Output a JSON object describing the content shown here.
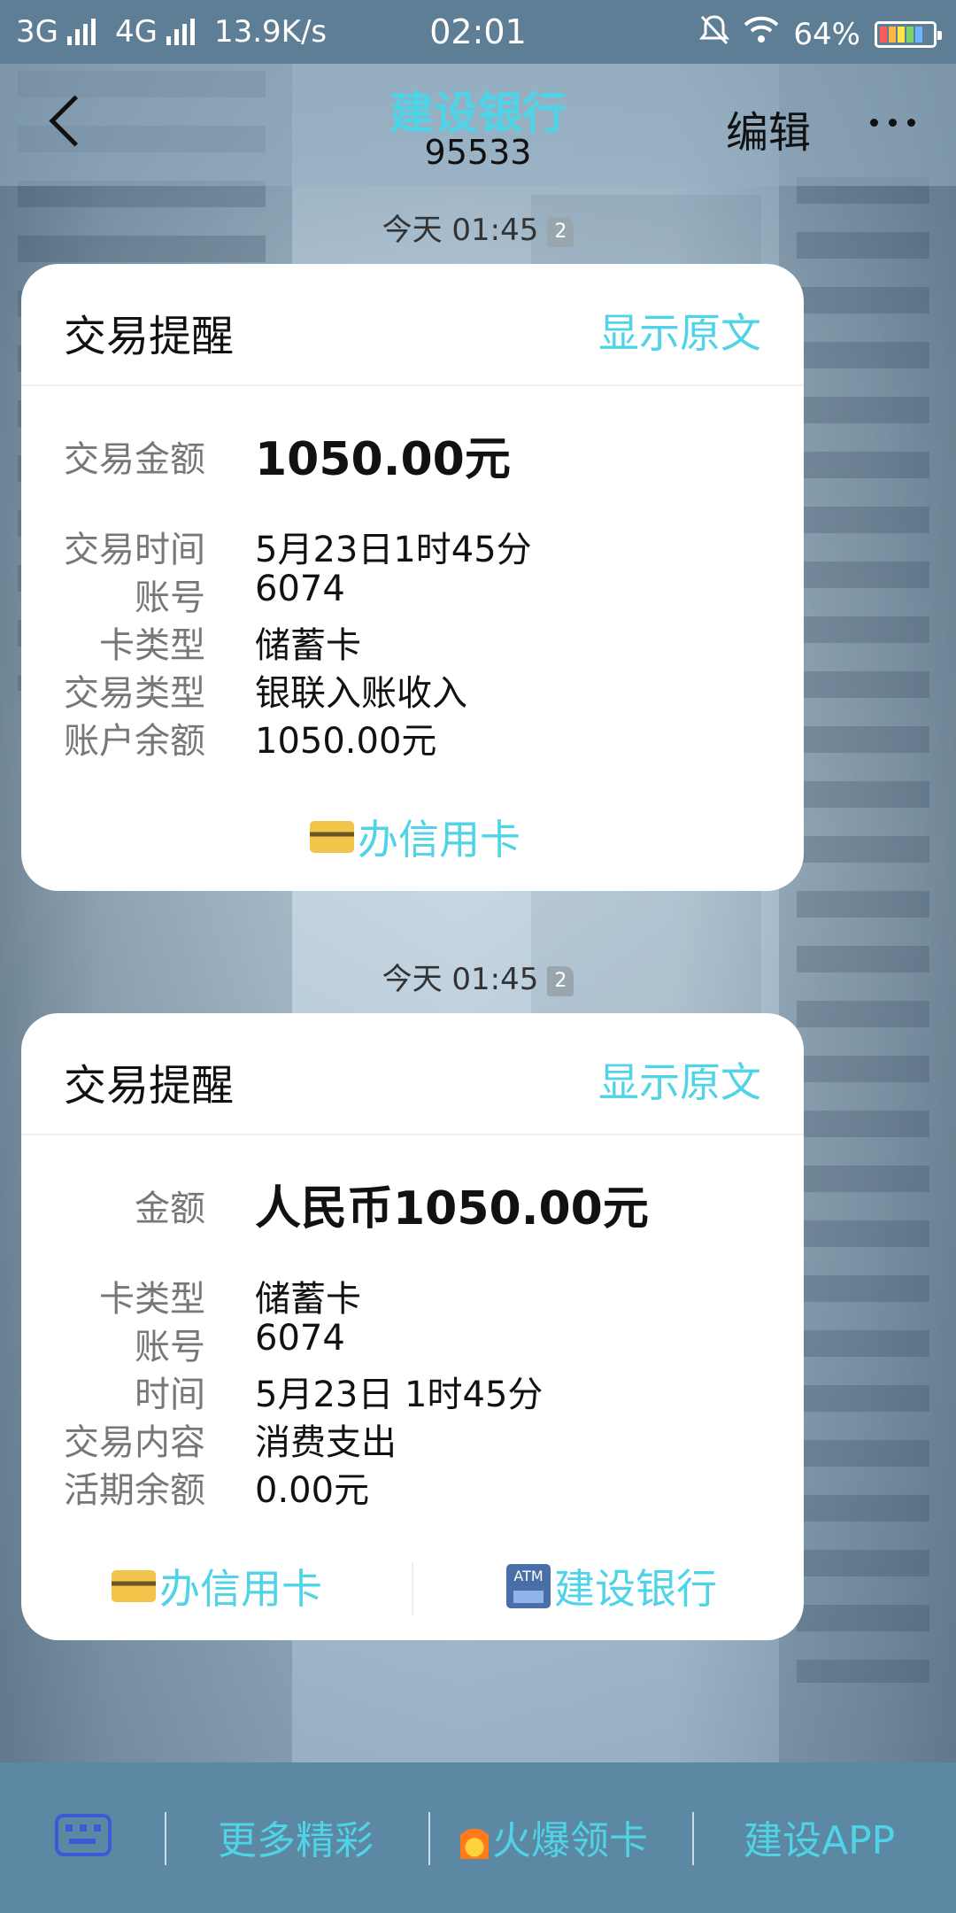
{
  "status_bar": {
    "network1": "3G",
    "network2": "4G",
    "speed": "13.9K/s",
    "time": "02:01",
    "battery": "64%"
  },
  "header": {
    "title": "建设银行",
    "number": "95533",
    "edit_label": "编辑"
  },
  "messages": [
    {
      "timestamp": "今天 01:45",
      "sim": "2",
      "card_title": "交易提醒",
      "show_original": "显示原文",
      "rows": [
        {
          "label": "交易金额",
          "value": "1050.00元"
        },
        {
          "label": "交易时间",
          "value": "5月23日1时45分"
        },
        {
          "label": "账号",
          "value": "6074"
        },
        {
          "label": "卡类型",
          "value": "储蓄卡"
        },
        {
          "label": "交易类型",
          "value": "银联入账收入"
        },
        {
          "label": "账户余额",
          "value": "1050.00元"
        }
      ],
      "footer_button": "办信用卡"
    },
    {
      "timestamp": "今天 01:45",
      "sim": "2",
      "card_title": "交易提醒",
      "show_original": "显示原文",
      "rows": [
        {
          "label": "金额",
          "value": "人民币1050.00元"
        },
        {
          "label": "卡类型",
          "value": "储蓄卡"
        },
        {
          "label": "账号",
          "value": "6074"
        },
        {
          "label": "时间",
          "value": "5月23日 1时45分"
        },
        {
          "label": "交易内容",
          "value": "消费支出"
        },
        {
          "label": "活期余额",
          "value": "0.00元"
        }
      ],
      "footer_buttons": [
        "办信用卡",
        "建设银行"
      ]
    }
  ],
  "bottom_bar": {
    "items": [
      "更多精彩",
      "火爆领卡",
      "建设APP"
    ]
  },
  "colors": {
    "accent": "#4fd3e6",
    "status_bar": "#5d7e95",
    "bottom_bar": "#5d88a3"
  }
}
